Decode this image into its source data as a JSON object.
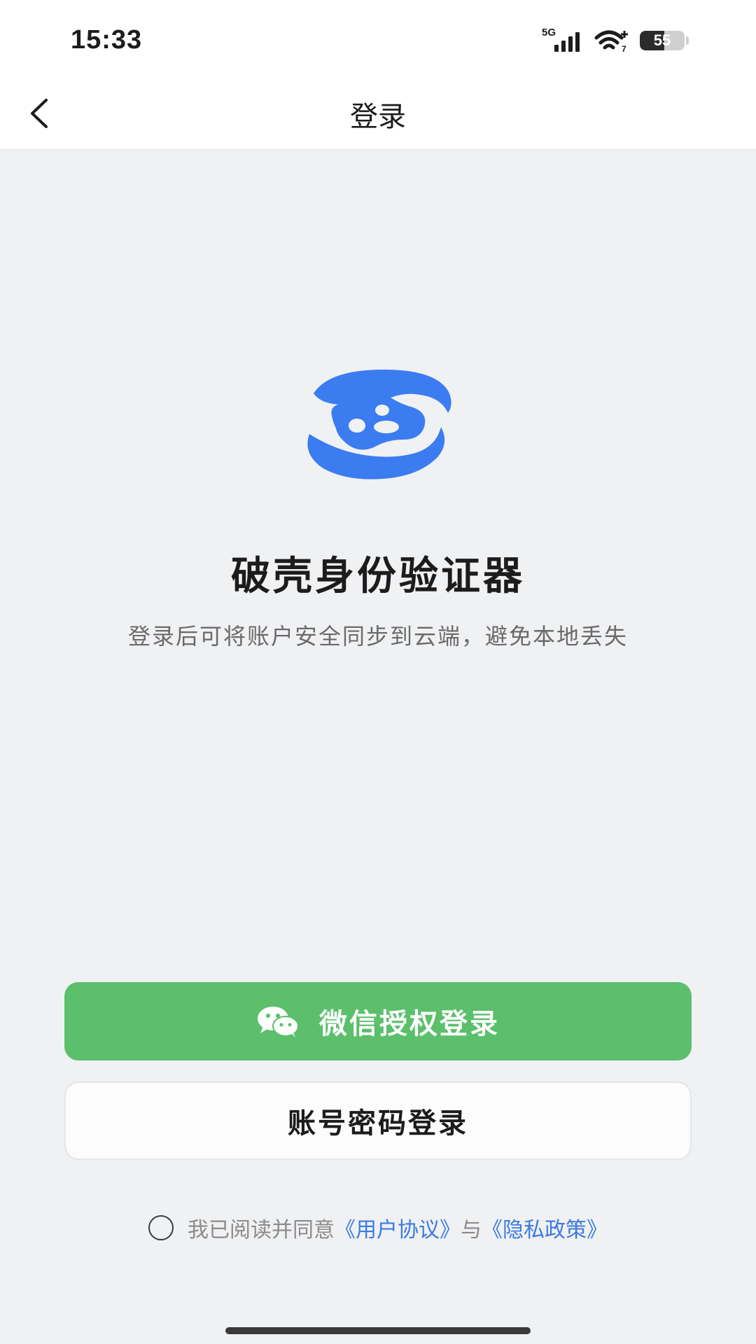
{
  "status_bar": {
    "time": "15:33",
    "network": "5G",
    "battery_level": "55",
    "battery_fraction": 0.55,
    "wifi_icon": "wifi-icon",
    "signal_icon": "signal-icon"
  },
  "nav": {
    "title": "登录",
    "back_icon": "chevron-left-icon"
  },
  "app": {
    "name": "破壳身份验证器",
    "description": "登录后可将账户安全同步到云端，避免本地丢失",
    "logo_icon": "app-logo-icon",
    "brand_color": "#3b7cf0"
  },
  "buttons": {
    "wechat_label": "微信授权登录",
    "wechat_icon": "wechat-icon",
    "wechat_color": "#5bbf6b",
    "password_label": "账号密码登录"
  },
  "agreement": {
    "prefix": "我已阅读并同意",
    "user_agreement": "《用户协议》",
    "conjunction": "与",
    "privacy_policy": "《隐私政策》",
    "link_color": "#3b7be0"
  }
}
